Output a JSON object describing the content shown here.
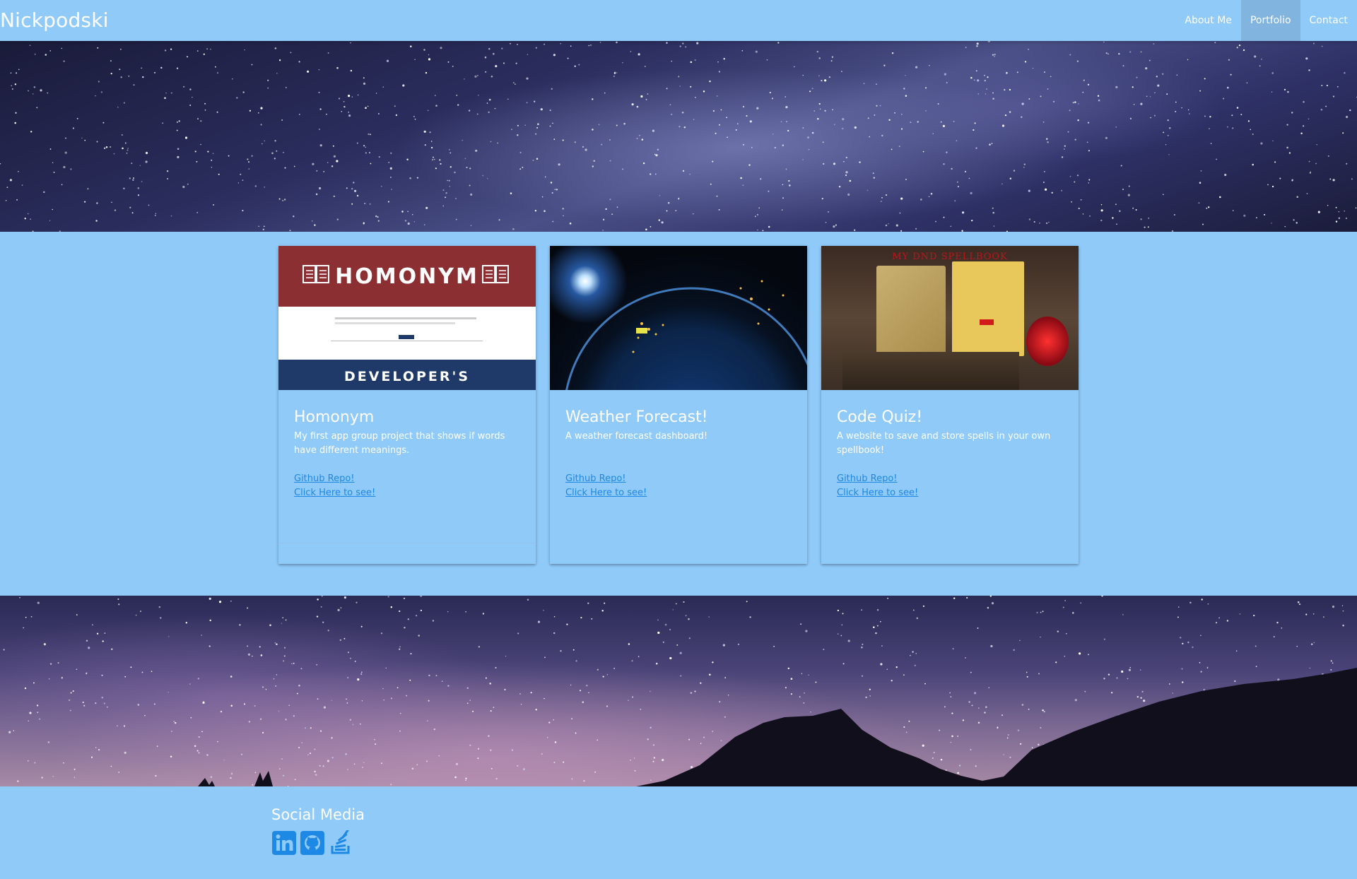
{
  "navbar": {
    "brand": "Nickpodski",
    "links": [
      {
        "label": "About Me",
        "active": false
      },
      {
        "label": "Portfolio",
        "active": true
      },
      {
        "label": "Contact",
        "active": false
      }
    ]
  },
  "cards": [
    {
      "title": "Homonym",
      "description": "My first app group project that shows if words have different meanings.",
      "links": [
        "Github Repo!",
        "Click Here to see!"
      ],
      "image": {
        "heading": "HOMONYM",
        "footer": "DEVELOPER'S"
      }
    },
    {
      "title": "Weather Forecast!",
      "description": "A weather forecast dashboard!",
      "links": [
        "Github Repo!",
        "Click Here to see!"
      ],
      "image": {}
    },
    {
      "title": "Code Quiz!",
      "description": "A website to save and store spells in your own spellbook!",
      "links": [
        "Github Repo!",
        "Click Here to see!"
      ],
      "image": {
        "heading": "MY DND SPELLBOOK"
      }
    }
  ],
  "footer": {
    "title": "Social Media",
    "icons": [
      "linkedin-icon",
      "github-icon",
      "stackoverflow-icon"
    ]
  },
  "colors": {
    "background": "#90caf9",
    "link": "#1e88e5",
    "text": "#ffffff"
  }
}
